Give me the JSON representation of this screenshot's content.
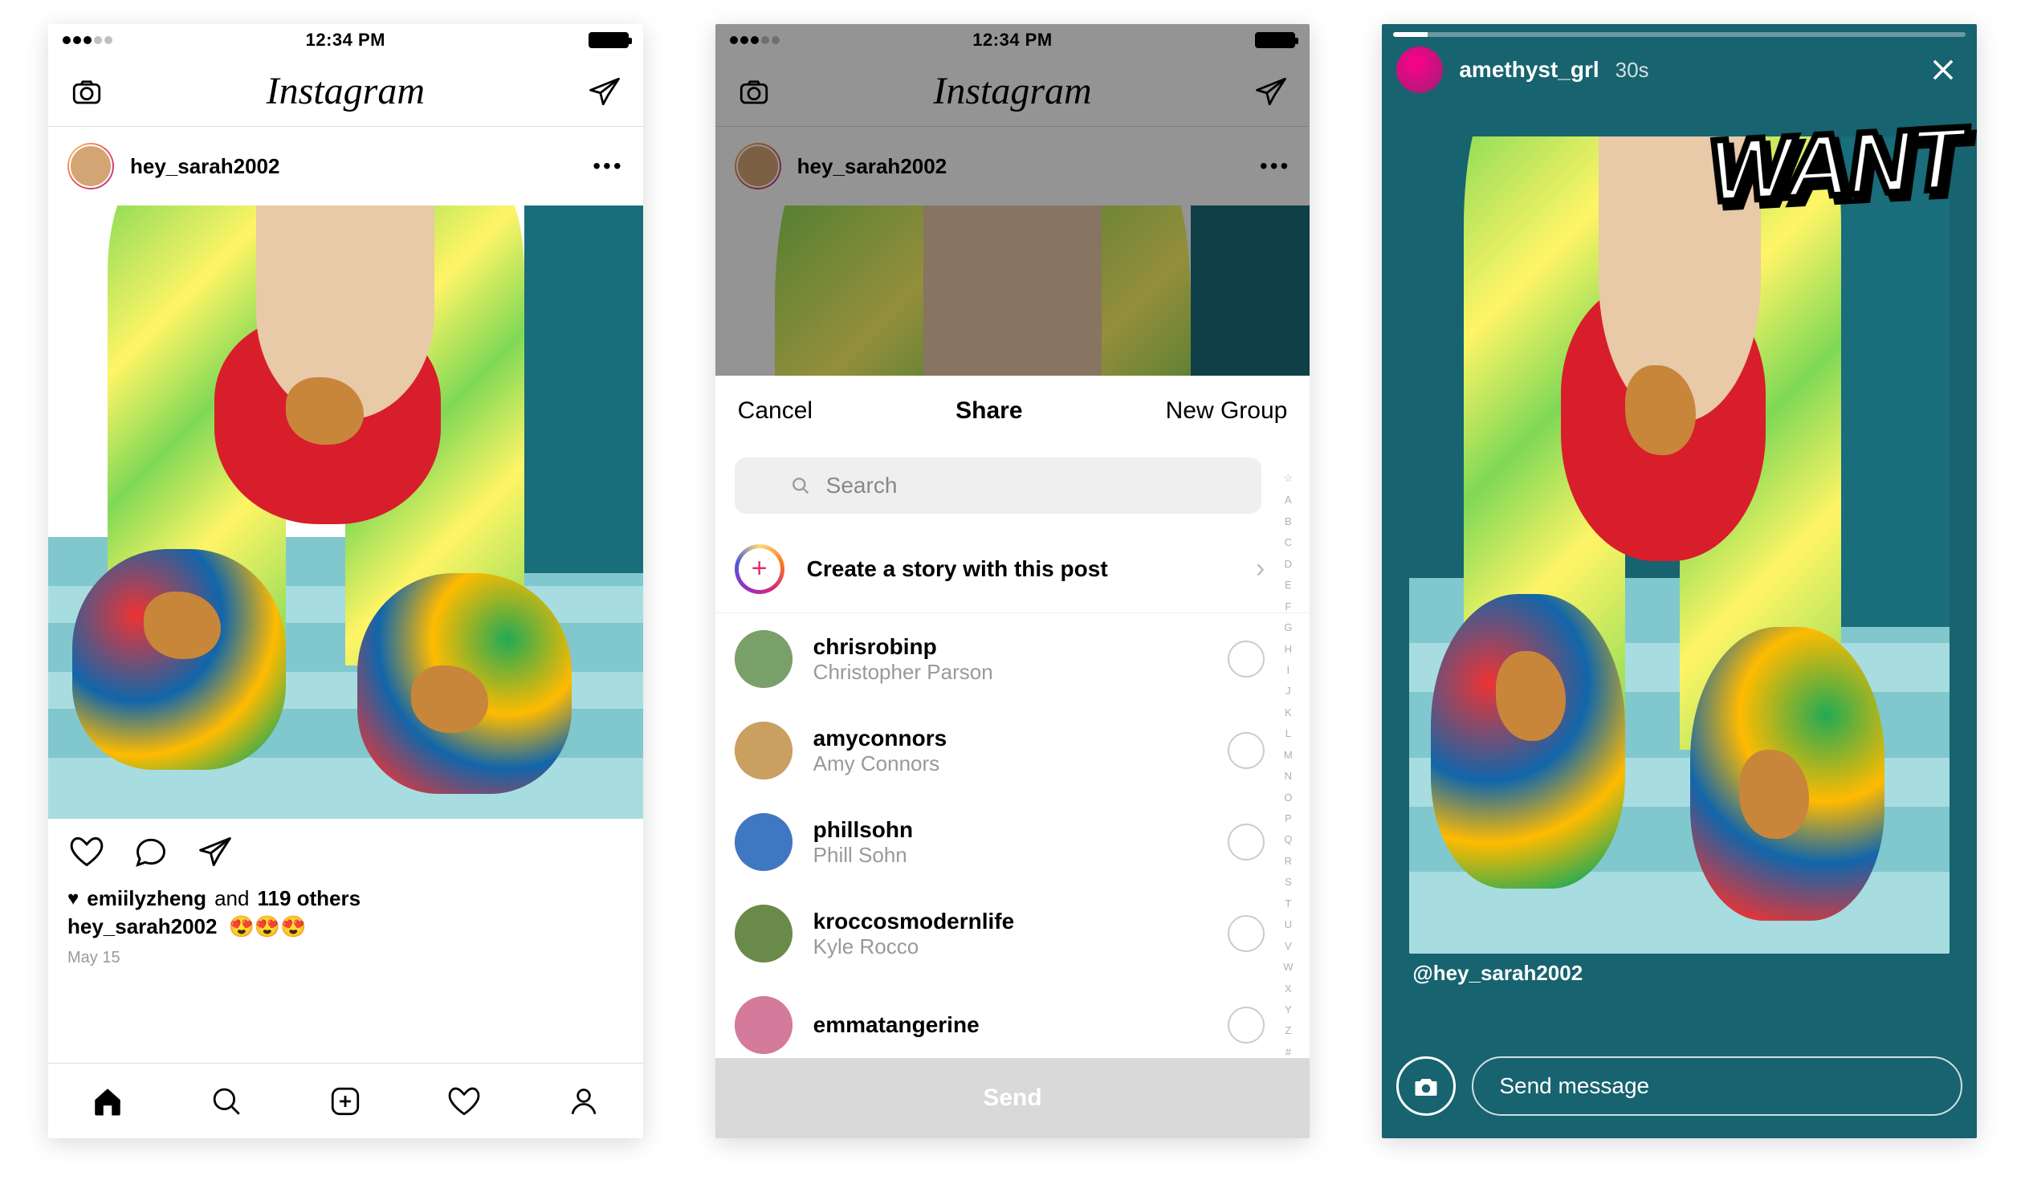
{
  "status": {
    "time": "12:34 PM"
  },
  "screen1": {
    "logo": "Instagram",
    "post": {
      "username": "hey_sarah2002",
      "liked_by_name": "emiilyzheng",
      "liked_by_connector": "and",
      "liked_by_count": "119 others",
      "caption_user": "hey_sarah2002",
      "caption_emoji": "😍😍😍",
      "date": "May 15"
    }
  },
  "screen2": {
    "logo": "Instagram",
    "post_username": "hey_sarah2002",
    "sheet": {
      "cancel": "Cancel",
      "title": "Share",
      "new_group": "New Group",
      "search_placeholder": "Search",
      "create_story": "Create a story with this post",
      "recipients": [
        {
          "user": "chrisrobinp",
          "name": "Christopher Parson"
        },
        {
          "user": "amyconnors",
          "name": "Amy Connors"
        },
        {
          "user": "phillsohn",
          "name": "Phill Sohn"
        },
        {
          "user": "kroccosmodernlife",
          "name": "Kyle Rocco"
        },
        {
          "user": "emmatangerine",
          "name": ""
        }
      ],
      "alpha_index": [
        "☆",
        "A",
        "B",
        "C",
        "D",
        "E",
        "F",
        "G",
        "H",
        "I",
        "J",
        "K",
        "L",
        "M",
        "N",
        "O",
        "P",
        "Q",
        "R",
        "S",
        "T",
        "U",
        "V",
        "W",
        "X",
        "Y",
        "Z",
        "#"
      ],
      "send": "Send"
    }
  },
  "screen3": {
    "user": "amethyst_grl",
    "time": "30s",
    "sticker": "WANT",
    "attribution": "@hey_sarah2002",
    "message_placeholder": "Send message"
  }
}
